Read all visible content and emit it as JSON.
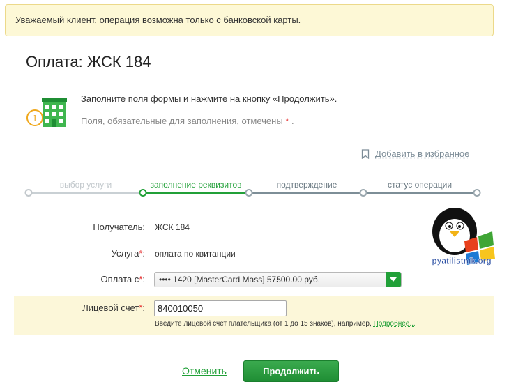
{
  "notice": {
    "text": "Уважаемый клиент, операция возможна только с банковской карты."
  },
  "page": {
    "title": "Оплата: ЖСК 184"
  },
  "instructions": {
    "line1": "Заполните поля формы и нажмите на кнопку «Продолжить».",
    "line2": "Поля, обязательные для заполнения, отмечены",
    "star": "*",
    "suffix": " ."
  },
  "step_badge": "1",
  "favorite": {
    "label": "Добавить в избранное",
    "icon": "bookmark-icon"
  },
  "steps": [
    {
      "label": "выбор услуги",
      "state": "done"
    },
    {
      "label": "заполнение реквизитов",
      "state": "active"
    },
    {
      "label": "подтверждение",
      "state": "pending"
    },
    {
      "label": "статус операции",
      "state": "pending"
    }
  ],
  "form": {
    "recipient_label": "Получатель:",
    "recipient_value": "ЖСК 184",
    "service_label": "Услуга",
    "service_value": "оплата по квитанции",
    "payment_label": "Оплата с",
    "payment_value": "•••• 1420 [MasterCard Mass] 57500.00 руб.",
    "account_label": "Лицевой счет",
    "account_value": "840010050",
    "account_hint": "Введите лицевой счет плательщика (от 1 до 15 знаков), например,",
    "account_hint_link": "Подробнее...",
    "required_mark": "*",
    "colon": ":"
  },
  "buttons": {
    "cancel": "Отменить",
    "continue": "Продолжить"
  },
  "watermark": {
    "text": "pyatilistnik.org"
  },
  "colors": {
    "accent_green": "#21a038",
    "step_done": "#c9d0d4",
    "step_pending": "#9aa7ae",
    "required_red": "#e52b2b",
    "notice_bg": "#fdf8d6"
  }
}
